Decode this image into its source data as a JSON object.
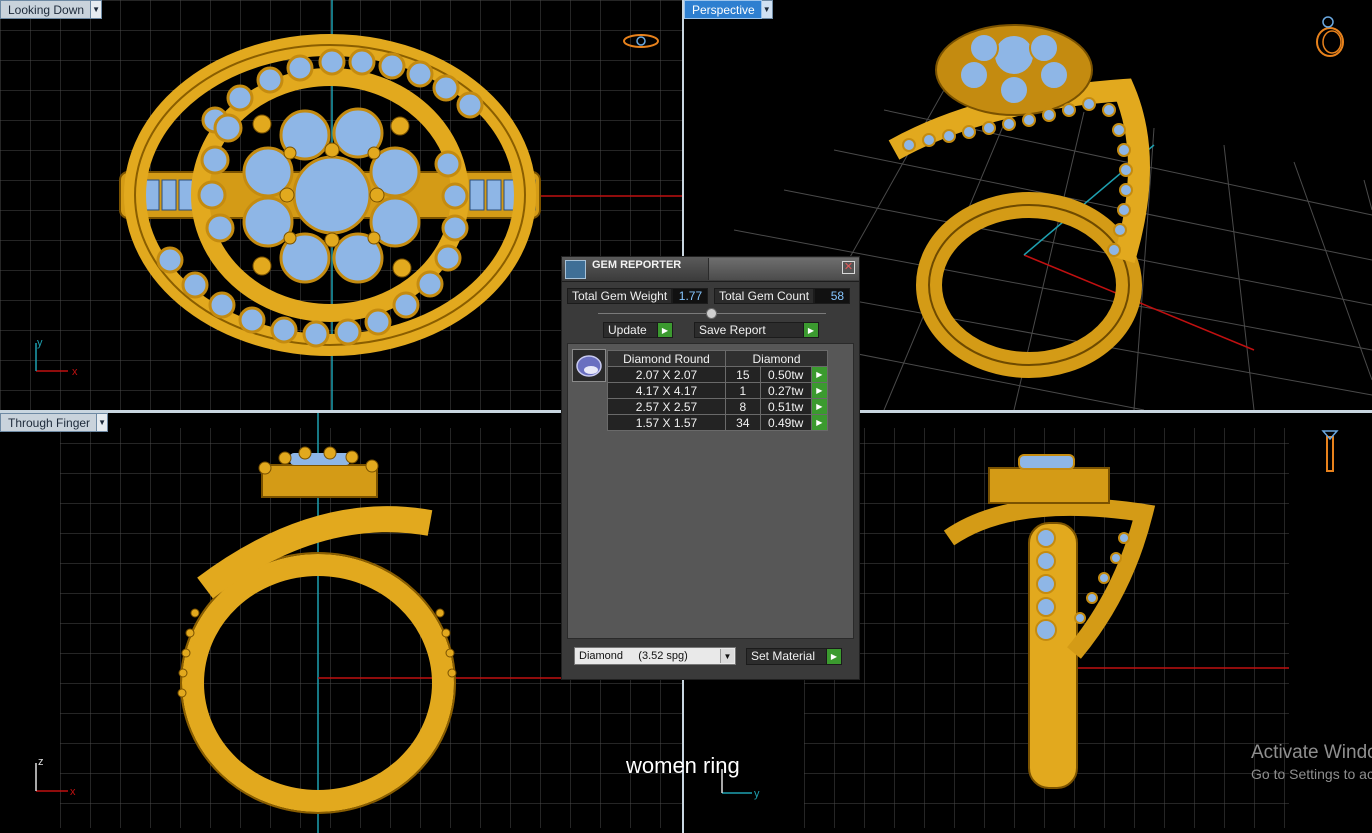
{
  "viewports": {
    "top_left": {
      "label": "Looking Down"
    },
    "top_right": {
      "label": "Perspective"
    },
    "bottom_left": {
      "label": "Through Finger"
    }
  },
  "axes": {
    "y": "y",
    "x": "x",
    "z": "z"
  },
  "gem_reporter": {
    "title": "GEM REPORTER",
    "total_weight_label": "Total Gem Weight",
    "total_weight_value": "1.77",
    "total_count_label": "Total Gem Count",
    "total_count_value": "58",
    "update_label": "Update",
    "save_report_label": "Save Report",
    "table": {
      "headers": [
        "Diamond Round",
        "Diamond"
      ],
      "rows": [
        {
          "size": "2.07 X 2.07",
          "count": "15",
          "weight": "0.50tw"
        },
        {
          "size": "4.17 X 4.17",
          "count": "1",
          "weight": "0.27tw"
        },
        {
          "size": "2.57 X 2.57",
          "count": "8",
          "weight": "0.51tw"
        },
        {
          "size": "1.57 X 1.57",
          "count": "34",
          "weight": "0.49tw"
        }
      ]
    },
    "material_select": "Diamond     (3.52 spg)",
    "set_material_label": "Set Material"
  },
  "caption": "women ring",
  "watermark": {
    "line1": "Activate Windows",
    "line2": "Go to Settings to activate Windows."
  },
  "colors": {
    "gold": "#e2a91e",
    "gem": "#8eb6e6",
    "axis_red": "#c01010",
    "axis_cyan": "#1ea0b0",
    "accent_blue": "#2e7fd0"
  }
}
